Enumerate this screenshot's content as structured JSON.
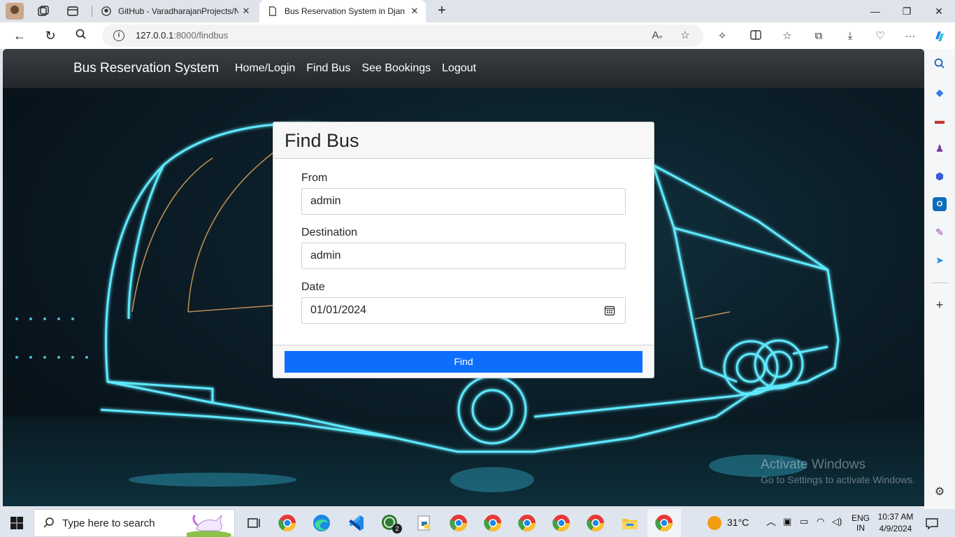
{
  "browser": {
    "tabs": [
      {
        "title": "GitHub - VaradharajanProjects/N",
        "active": false
      },
      {
        "title": "Bus Reservation System in Djang",
        "active": true
      }
    ],
    "url_host": "127.0.0.1",
    "url_rest": ":8000/findbus"
  },
  "navbar": {
    "brand": "Bus Reservation System",
    "links": [
      "Home/Login",
      "Find Bus",
      "See Bookings",
      "Logout"
    ]
  },
  "form": {
    "title": "Find Bus",
    "fields": [
      {
        "label": "From",
        "value": "admin"
      },
      {
        "label": "Destination",
        "value": "admin"
      },
      {
        "label": "Date",
        "value": "01/01/2024"
      }
    ],
    "submit_label": "Find"
  },
  "watermark": {
    "title": "Activate Windows",
    "subtitle": "Go to Settings to activate Windows."
  },
  "taskbar": {
    "search_placeholder": "Type here to search",
    "whatsapp_badge": "2",
    "weather": "31°C",
    "lang_top": "ENG",
    "lang_bottom": "IN",
    "time": "10:37 AM",
    "date": "4/9/2024"
  },
  "colors": {
    "primary_button": "#0d6efd",
    "navbar": "#2b3035",
    "neon": "#4fe3ff"
  }
}
